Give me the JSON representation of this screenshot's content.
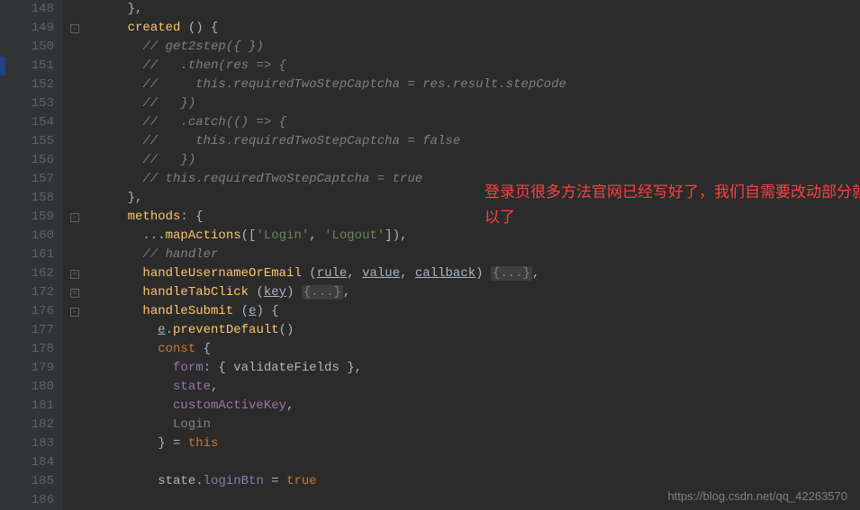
{
  "lineNumbers": [
    "148",
    "149",
    "150",
    "151",
    "152",
    "153",
    "154",
    "155",
    "156",
    "157",
    "158",
    "159",
    "160",
    "161",
    "162",
    "172",
    "176",
    "177",
    "178",
    "179",
    "180",
    "181",
    "182",
    "183",
    "184",
    "185",
    "186"
  ],
  "code": {
    "l148": "    },",
    "l149_a": "    ",
    "l149_b": "created",
    "l149_c": " () {",
    "l150": "      // get2step({ })",
    "l151": "      //   .then(res => {",
    "l152": "      //     this.requiredTwoStepCaptcha = res.result.stepCode",
    "l153": "      //   })",
    "l154": "      //   .catch(() => {",
    "l155": "      //     this.requiredTwoStepCaptcha = false",
    "l156": "      //   })",
    "l157": "      // this.requiredTwoStepCaptcha = true",
    "l158": "    },",
    "l159_a": "    ",
    "l159_b": "methods",
    "l159_c": ": {",
    "l160_a": "      ...",
    "l160_b": "mapActions",
    "l160_c": "([",
    "l160_d": "'Login'",
    "l160_e": ", ",
    "l160_f": "'Logout'",
    "l160_g": "]),",
    "l161": "      // handler",
    "l162_a": "      ",
    "l162_b": "handleUsernameOrEmail",
    "l162_c": " (",
    "l162_d": "rule",
    "l162_e": ", ",
    "l162_f": "value",
    "l162_g": ", ",
    "l162_h": "callback",
    "l162_i": ") ",
    "l162_j": "{...}",
    "l162_k": ",",
    "l172_a": "      ",
    "l172_b": "handleTabClick",
    "l172_c": " (",
    "l172_d": "key",
    "l172_e": ") ",
    "l172_f": "{...}",
    "l172_g": ",",
    "l176_a": "      ",
    "l176_b": "handleSubmit",
    "l176_c": " (",
    "l176_d": "e",
    "l176_e": ") {",
    "l177_a": "        ",
    "l177_b": "e",
    "l177_c": ".",
    "l177_d": "preventDefault",
    "l177_e": "()",
    "l178_a": "        ",
    "l178_b": "const",
    "l178_c": " {",
    "l179_a": "          ",
    "l179_b": "form",
    "l179_c": ": { ",
    "l179_d": "validateFields",
    "l179_e": " },",
    "l180_a": "          ",
    "l180_b": "state",
    "l180_c": ",",
    "l181_a": "          ",
    "l181_b": "customActiveKey",
    "l181_c": ",",
    "l182_a": "          ",
    "l182_b": "Login",
    "l183_a": "        } = ",
    "l183_b": "this",
    "l184": "",
    "l185_a": "        ",
    "l185_b": "state",
    "l185_c": ".",
    "l185_d": "loginBtn",
    "l185_e": " = ",
    "l185_f": "true",
    "l186": ""
  },
  "annotation": {
    "line1": "登录页很多方法官网已经写好了，我们自需要改动部分就可",
    "line2": "以了"
  },
  "watermark": "https://blog.csdn.net/qq_42263570"
}
